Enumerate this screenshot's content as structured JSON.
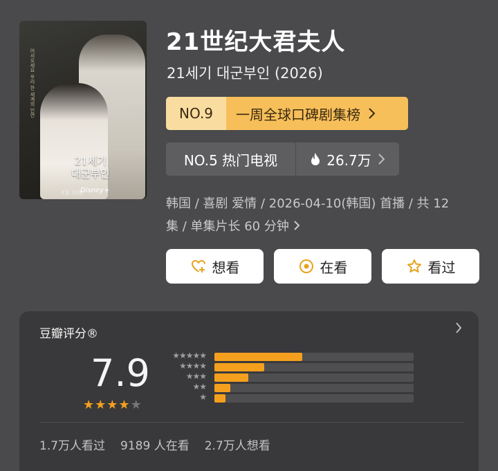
{
  "poster": {
    "title_line1": "21세기",
    "title_line2": "대군부인",
    "date_text": "4월 10일",
    "brand_text": "Disney+",
    "vertical_text": "어서오세요 우리 한 세계의 인연"
  },
  "title": "21世纪大君夫人",
  "subtitle": "21세기 대군부인 (2026)",
  "rank_badge": {
    "rank": "NO.9",
    "label": "一周全球口碑剧集榜"
  },
  "hot_badge": {
    "rank_label": "NO.5 热门电视",
    "heat": "26.7万"
  },
  "meta": {
    "line1": "韩国 / 喜剧 爱情 / 2026-04-10(韩国) 首播 / 共 12",
    "line2": "集 / 单集片长 60 分钟"
  },
  "actions": {
    "want_label": "想看",
    "watching_label": "在看",
    "watched_label": "看过"
  },
  "rating": {
    "label": "豆瓣评分®",
    "score": "7.9",
    "stars_fraction": 0.8,
    "distribution_fraction": [
      0.44,
      0.25,
      0.17,
      0.08,
      0.055
    ],
    "counts": {
      "watched": "1.7万人看过",
      "watching": "9189 人在看",
      "want": "2.7万人想看"
    }
  },
  "colors": {
    "background": "#4a4a4c",
    "accent": "#f4a01e",
    "badge_light": "#f9dca0",
    "badge_dark": "#f7bf5a"
  }
}
